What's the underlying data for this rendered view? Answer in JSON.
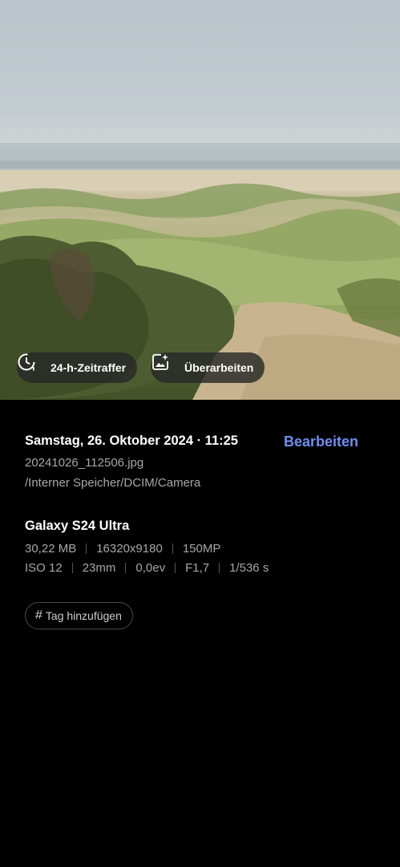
{
  "photo_actions": {
    "timelapse_label": "24-h-Zeitraffer",
    "remaster_label": "Überarbeiten"
  },
  "details": {
    "date_time": "Samstag, 26. Oktober 2024 · 11:25",
    "edit_label": "Bearbeiten",
    "filename": "20241026_112506.jpg",
    "path": "/Interner Speicher/DCIM/Camera"
  },
  "device": {
    "model": "Galaxy S24 Ultra",
    "file_size": "30,22 MB",
    "resolution": "16320x9180",
    "megapixels": "150MP",
    "iso": "ISO 12",
    "focal_length": "23mm",
    "exposure_value": "0,0ev",
    "aperture": "F1,7",
    "shutter": "1/536 s"
  },
  "tags": {
    "add_tag_label": "Tag hinzufügen"
  },
  "icons": {
    "timelapse": "clock-history-icon",
    "remaster": "sparkle-image-icon",
    "tag": "hash-icon"
  },
  "colors": {
    "accent": "#6f8ef2",
    "background": "#000000",
    "secondary_text": "#a7a7a7"
  }
}
